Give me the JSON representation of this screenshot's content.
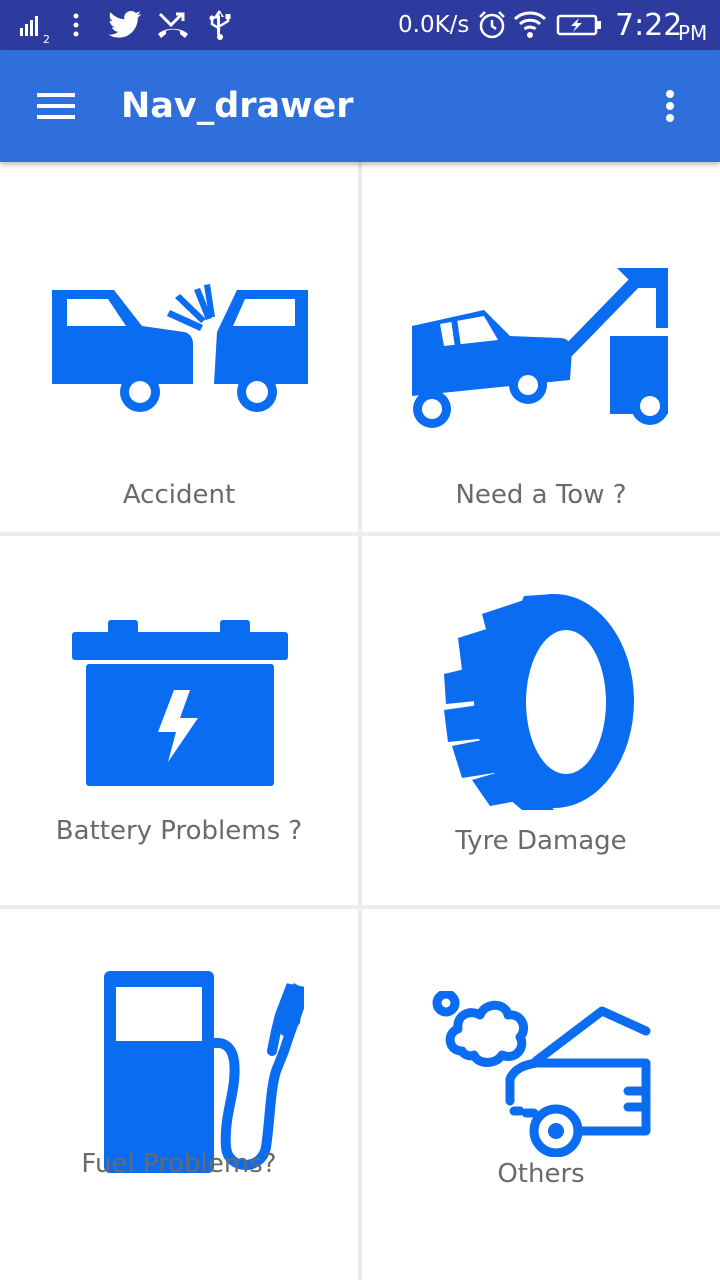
{
  "status_bar": {
    "sim_slot": "2",
    "network_speed": "0.0K/s",
    "time": "7:22",
    "ampm": "PM",
    "icons": [
      "signal-icon",
      "more-notifications-icon",
      "twitter-icon",
      "missed-call-icon",
      "usb-icon",
      "alarm-icon",
      "wifi-icon",
      "battery-charging-icon"
    ]
  },
  "app_bar": {
    "title": "Nav_drawer",
    "background_color": "#2f6fdc",
    "icons": [
      "menu-icon",
      "overflow-menu-icon"
    ]
  },
  "accent_color": "#0a6cf0",
  "tiles": [
    {
      "label": "Accident",
      "icon": "car-crash-icon"
    },
    {
      "label": "Need a Tow ?",
      "icon": "tow-truck-icon"
    },
    {
      "label": "Battery Problems ?",
      "icon": "battery-icon"
    },
    {
      "label": "Tyre Damage",
      "icon": "tyre-icon"
    },
    {
      "label": "Fuel Problems?",
      "icon": "fuel-pump-icon"
    },
    {
      "label": "Others",
      "icon": "engine-smoke-icon"
    }
  ]
}
